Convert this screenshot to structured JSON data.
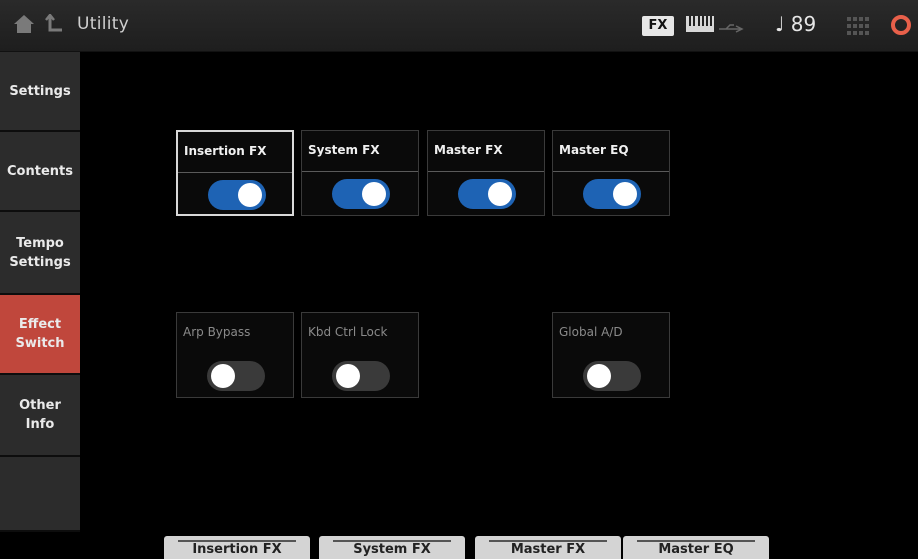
{
  "header": {
    "title": "Utility",
    "fx_badge": "FX",
    "tempo": "♩ 89",
    "icons": [
      "home-icon",
      "back-icon",
      "keyboard-icon",
      "usb-icon",
      "grid-icon",
      "power-icon"
    ]
  },
  "sidebar": {
    "items": [
      {
        "label": "Settings",
        "active": false
      },
      {
        "label": "Contents",
        "active": false
      },
      {
        "label": "Tempo\nSettings",
        "active": false
      },
      {
        "label": "Effect\nSwitch",
        "active": true
      },
      {
        "label": "Other\nInfo",
        "active": false
      },
      {
        "label": "",
        "active": false
      }
    ]
  },
  "switches": {
    "row1": [
      {
        "label": "Insertion FX",
        "on": true,
        "selected": true
      },
      {
        "label": "System FX",
        "on": true,
        "selected": false
      },
      {
        "label": "Master FX",
        "on": true,
        "selected": false
      },
      {
        "label": "Master EQ",
        "on": true,
        "selected": false
      }
    ],
    "row2": [
      {
        "label": "Arp Bypass",
        "on": false
      },
      {
        "label": "Kbd Ctrl Lock",
        "on": false
      },
      {
        "label": "Global A/D",
        "on": false
      }
    ]
  },
  "bottom_tabs": [
    "Insertion FX",
    "System FX",
    "Master FX",
    "Master EQ"
  ],
  "colors": {
    "accent_active": "#c0473c",
    "toggle_on": "#1e63b4",
    "toggle_off": "#3a3a3a"
  }
}
